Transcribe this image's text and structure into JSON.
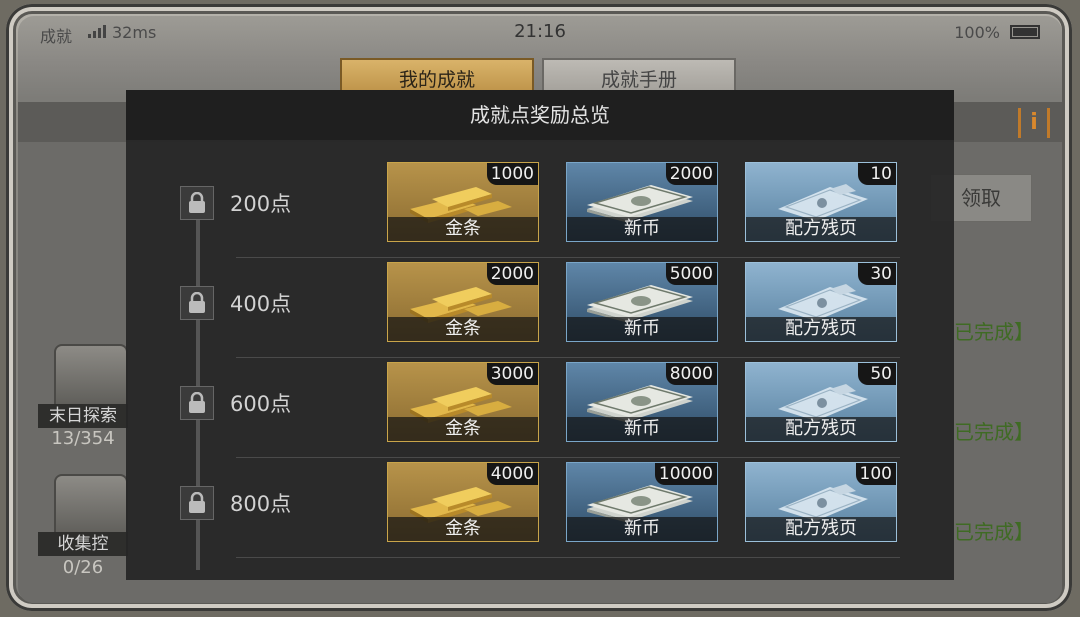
{
  "status_bar": {
    "carrier": "成就",
    "ping": "32ms",
    "time": "21:16",
    "battery": "100%"
  },
  "tabs": [
    {
      "label": "我的成就",
      "active": true
    },
    {
      "label": "成就手册",
      "active": false
    }
  ],
  "background": {
    "info_icon": "info-icon",
    "claim_label": "领取",
    "completed_label": "已完成】",
    "sidebar": [
      {
        "label": "末日探索",
        "count": "13/354",
        "icon": "binoculars-icon"
      },
      {
        "label": "收集控",
        "count": "0/26",
        "icon": "chest-icon"
      }
    ]
  },
  "modal": {
    "title": "成就点奖励总览",
    "tiers": [
      {
        "points_label": "200点",
        "rewards": [
          {
            "name": "金条",
            "qty": "1000",
            "icon": "gold-bar-icon"
          },
          {
            "name": "新币",
            "qty": "2000",
            "icon": "banknote-icon"
          },
          {
            "name": "配方残页",
            "qty": "10",
            "icon": "recipe-page-icon"
          }
        ]
      },
      {
        "points_label": "400点",
        "rewards": [
          {
            "name": "金条",
            "qty": "2000",
            "icon": "gold-bar-icon"
          },
          {
            "name": "新币",
            "qty": "5000",
            "icon": "banknote-icon"
          },
          {
            "name": "配方残页",
            "qty": "30",
            "icon": "recipe-page-icon"
          }
        ]
      },
      {
        "points_label": "600点",
        "rewards": [
          {
            "name": "金条",
            "qty": "3000",
            "icon": "gold-bar-icon"
          },
          {
            "name": "新币",
            "qty": "8000",
            "icon": "banknote-icon"
          },
          {
            "name": "配方残页",
            "qty": "50",
            "icon": "recipe-page-icon"
          }
        ]
      },
      {
        "points_label": "800点",
        "rewards": [
          {
            "name": "金条",
            "qty": "4000",
            "icon": "gold-bar-icon"
          },
          {
            "name": "新币",
            "qty": "10000",
            "icon": "banknote-icon"
          },
          {
            "name": "配方残页",
            "qty": "100",
            "icon": "recipe-page-icon"
          }
        ]
      }
    ]
  },
  "colors": {
    "gold_border": "#c9a54a",
    "coin_border": "#7aa6c8",
    "recipe_border": "#9cc0da",
    "completed_text": "#3f6b24",
    "info_accent": "#d9882d"
  }
}
